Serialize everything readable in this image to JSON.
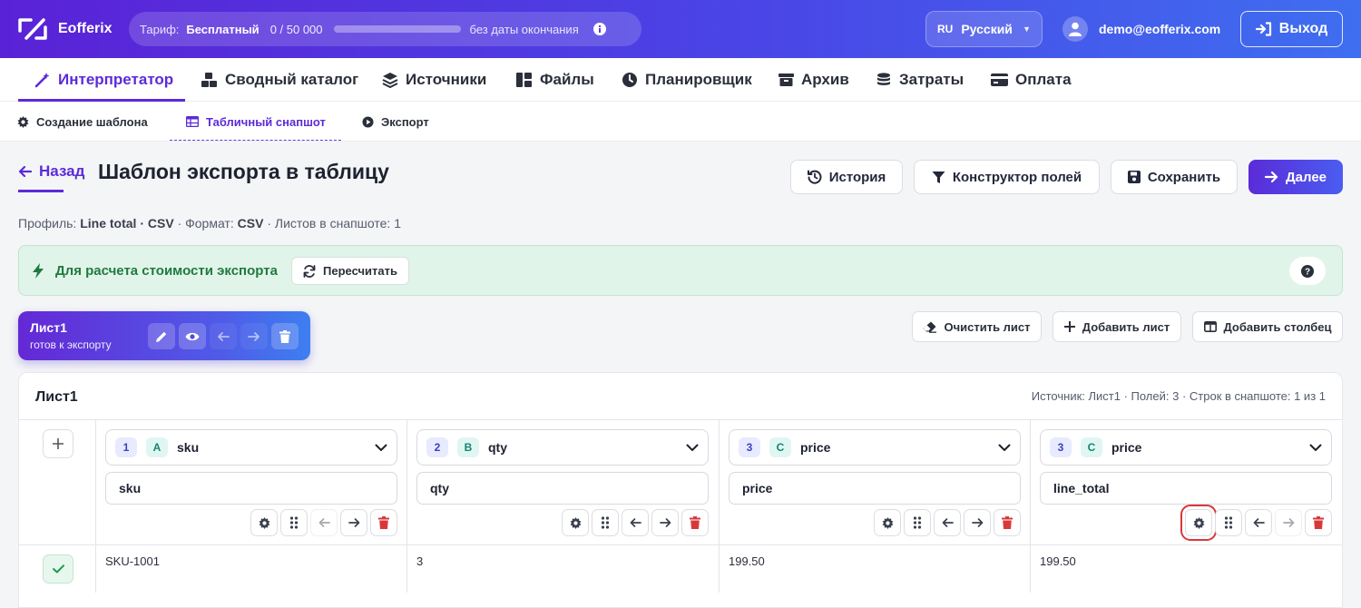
{
  "topbar": {
    "app_name": "Eofferix",
    "tariff_label": "Тариф:",
    "tariff_plan": "Бесплатный",
    "tariff_count": "0  /  50 000",
    "tariff_usage": 0,
    "tariff_expiry": "без даты окончания",
    "lang_code": "RU",
    "lang_name": "Русский",
    "user_email": "demo@eofferix.com",
    "logout_label": "Выход"
  },
  "nav": {
    "items": [
      {
        "label": "Интерпретатор",
        "icon": "magic-wand-icon",
        "active": true
      },
      {
        "label": "Сводный каталог",
        "icon": "boxes-icon"
      },
      {
        "label": "Источники",
        "icon": "layers-icon"
      },
      {
        "label": "Файлы",
        "icon": "files-icon"
      },
      {
        "label": "Планировщик",
        "icon": "clock-icon"
      },
      {
        "label": "Архив",
        "icon": "archive-icon"
      },
      {
        "label": "Затраты",
        "icon": "coins-icon"
      },
      {
        "label": "Оплата",
        "icon": "card-icon"
      }
    ]
  },
  "subnav": {
    "items": [
      {
        "label": "Создание шаблона",
        "icon": "gear-icon"
      },
      {
        "label": "Табличный снапшот",
        "icon": "table-icon",
        "active": true
      },
      {
        "label": "Экспорт",
        "icon": "play-icon"
      }
    ]
  },
  "page": {
    "back_label": "Назад",
    "title": "Шаблон экспорта в таблицу",
    "history_label": "История",
    "fields_label": "Конструктор полей",
    "save_label": "Сохранить",
    "next_label": "Далее",
    "meta_profile_label": "Профиль:",
    "meta_profile_value": "Line total · CSV",
    "meta_format_label": "· Формат:",
    "meta_format_value": "CSV",
    "meta_sheets": "· Листов в снапшоте: 1"
  },
  "notice": {
    "text": "Для расчета стоимости экспорта",
    "recalc_label": "Пересчитать"
  },
  "sheet": {
    "name": "Лист1",
    "status": "готов к экспорту",
    "clear_label": "Очистить лист",
    "add_sheet_label": "Добавить лист",
    "add_column_label": "Добавить столбец"
  },
  "table": {
    "title": "Лист1",
    "info": "Источник: Лист1 · Полей: 3 · Строк в снапшоте: 1 из 1",
    "columns": [
      {
        "num": "1",
        "letter": "A",
        "source": "sku",
        "name": "sku",
        "cell": "SKU-1001"
      },
      {
        "num": "2",
        "letter": "B",
        "source": "qty",
        "name": "qty",
        "cell": "3"
      },
      {
        "num": "3",
        "letter": "C",
        "source": "price",
        "name": "price",
        "cell": "199.50"
      },
      {
        "num": "3",
        "letter": "C",
        "source": "price",
        "name": "line_total",
        "cell": "199.50"
      }
    ]
  },
  "colors": {
    "accent": "#5b2bd8",
    "success": "#1f7a3e",
    "danger": "#d9383a"
  }
}
